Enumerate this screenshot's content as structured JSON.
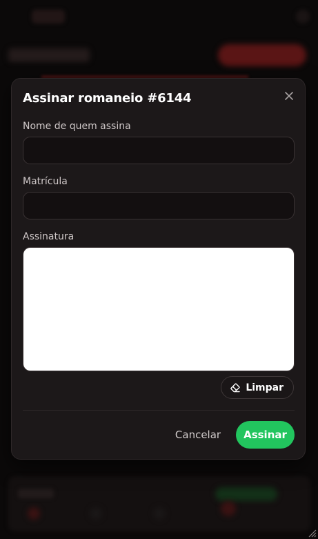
{
  "modal": {
    "title": "Assinar romaneio #6144",
    "close_icon": "close-icon",
    "signer_name": {
      "label": "Nome de quem assina",
      "value": "",
      "placeholder": ""
    },
    "registration": {
      "label": "Matrícula",
      "value": "",
      "placeholder": ""
    },
    "signature": {
      "label": "Assinatura",
      "pad_color": "#ffffff"
    },
    "clear_button": {
      "label": "Limpar",
      "icon": "eraser-icon"
    },
    "footer": {
      "cancel_label": "Cancelar",
      "submit_label": "Assinar"
    }
  },
  "colors": {
    "modal_bg": "#1c1819",
    "input_bg": "#130f10",
    "accent_green": "#22c55e",
    "backdrop": "#0b0909"
  }
}
